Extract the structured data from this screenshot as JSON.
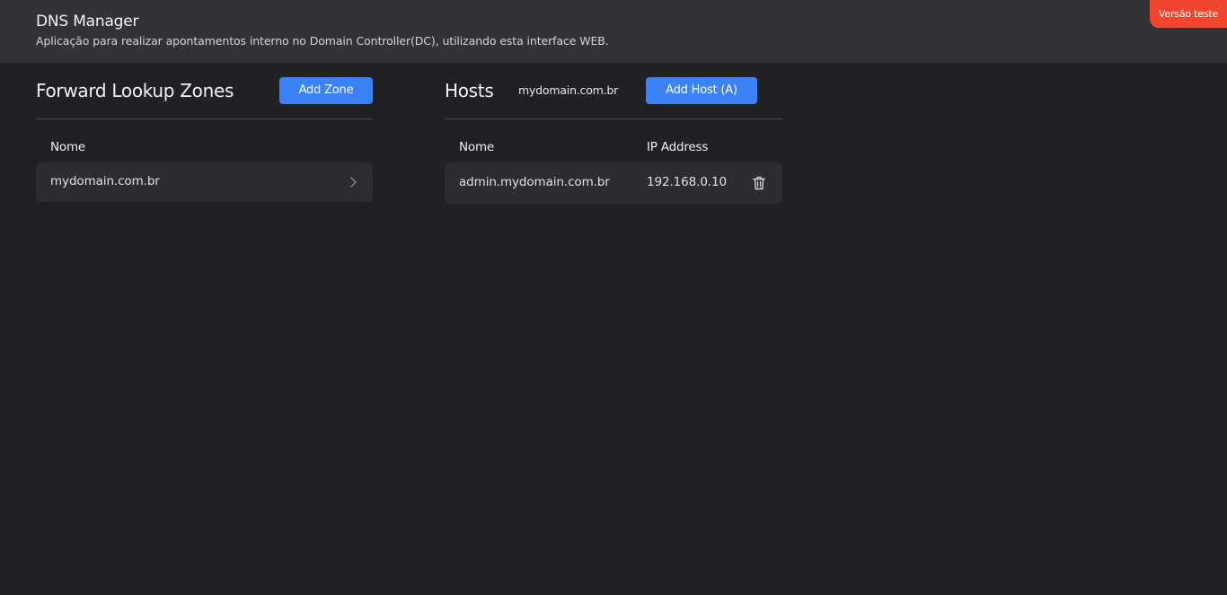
{
  "header": {
    "title": "DNS Manager",
    "subtitle": "Aplicação para realizar apontamentos interno no Domain Controller(DC), utilizando esta interface WEB.",
    "badge": "Versão teste"
  },
  "zones": {
    "title": "Forward Lookup Zones",
    "add_button": "Add Zone",
    "columns": [
      "Nome"
    ],
    "rows": [
      {
        "name": "mydomain.com.br"
      }
    ]
  },
  "hosts": {
    "title": "Hosts",
    "selected_zone": "mydomain.com.br",
    "add_button": "Add Host (A)",
    "columns": [
      "Nome",
      "IP Address"
    ],
    "rows": [
      {
        "name": "admin.mydomain.com.br",
        "ip": "192.168.0.10"
      }
    ]
  },
  "colors": {
    "background": "#202025",
    "header": "#323237",
    "accent": "#3b82f6",
    "badge": "#f2462e",
    "row": "#2c2c31"
  },
  "icons": {
    "row_action": "chevron-right-icon",
    "delete": "trash-icon"
  }
}
